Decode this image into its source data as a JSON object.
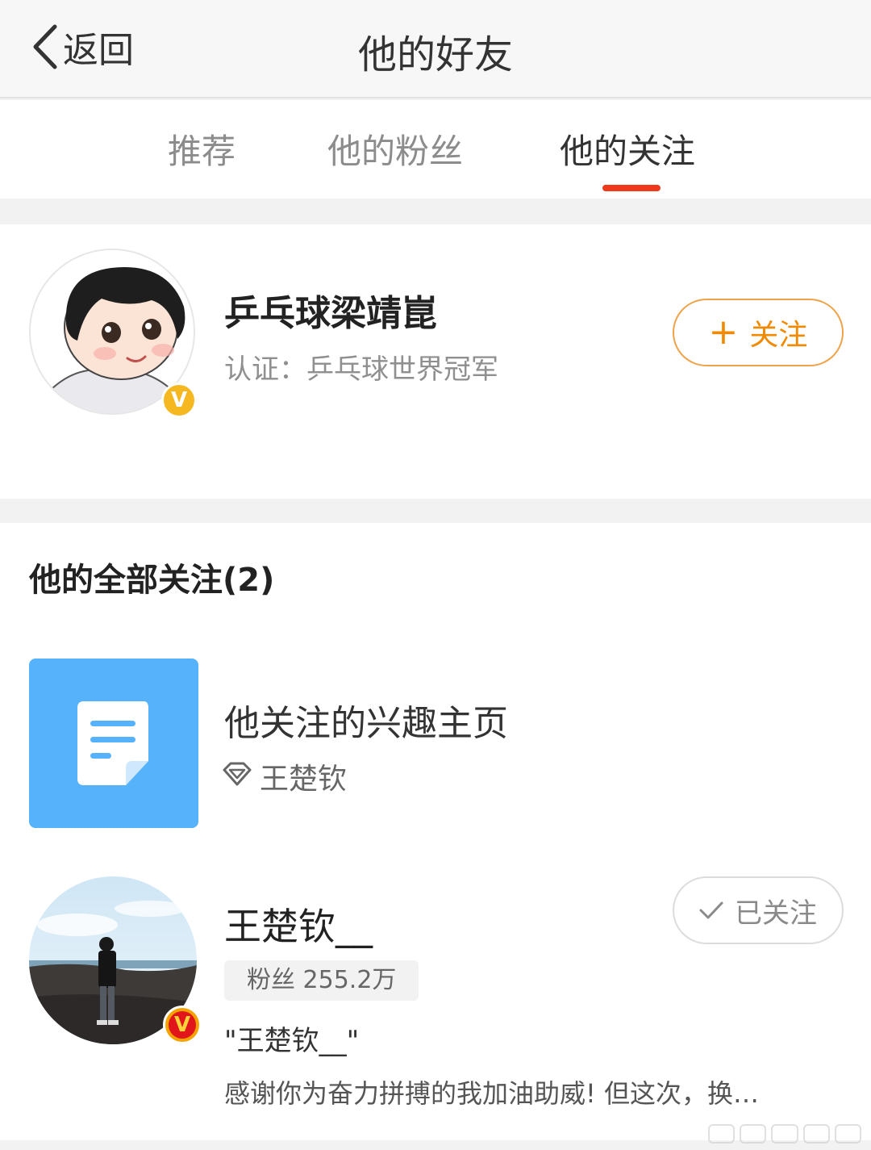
{
  "navbar": {
    "back_label": "返回",
    "title": "他的好友"
  },
  "tabs": [
    {
      "label": "推荐",
      "active": false
    },
    {
      "label": "他的粉丝",
      "active": false
    },
    {
      "label": "他的关注",
      "active": true
    }
  ],
  "featured": {
    "name": "乒乓球梁靖崑",
    "cert": "认证：乒乓球世界冠军",
    "verify_badge": "V",
    "follow_label": "关注",
    "follow_icon": "plus-icon"
  },
  "following": {
    "section_title": "他的全部关注(2)",
    "interest_page": {
      "title": "他关注的兴趣主页",
      "subtitle": "王楚钦",
      "icon": "document-icon"
    },
    "user": {
      "name": "王楚钦__",
      "fans": "粉丝 255.2万",
      "quote": "\"王楚钦__\"",
      "desc": "感谢你为奋力拼搏的我加油助威! 但这次，换…",
      "verify_badge": "V",
      "followed_label": "已关注"
    }
  },
  "colors": {
    "accent_orange": "#f08a00",
    "tab_underline": "#ee3a1a",
    "interest_blue": "#55b2fb"
  }
}
